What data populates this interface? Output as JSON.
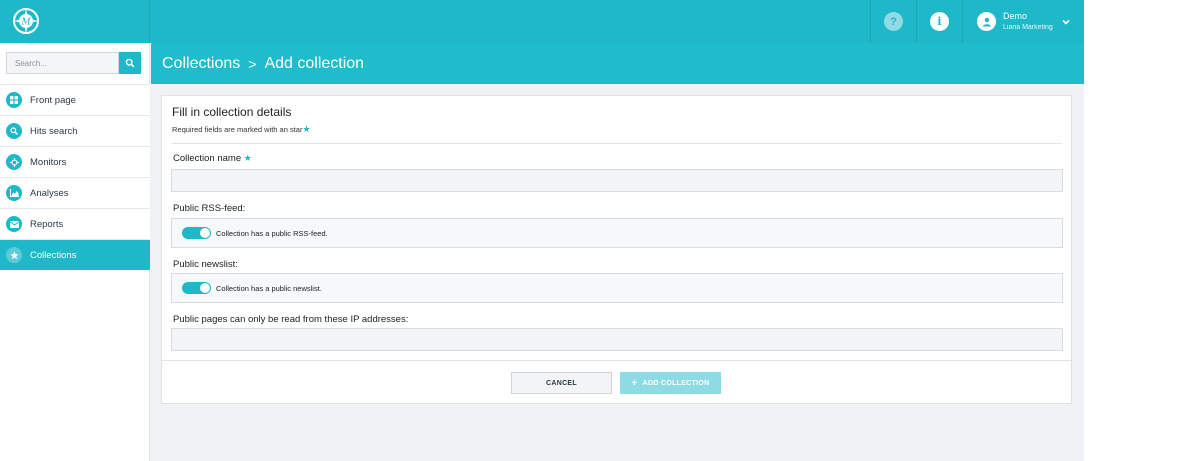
{
  "topbar": {
    "help_icon": "question-icon",
    "info_icon": "info-icon",
    "user": {
      "name": "Demo",
      "org": "Liana Marketing"
    }
  },
  "sidebar": {
    "search_placeholder": "Search...",
    "items": [
      {
        "label": "Front page",
        "icon": "dashboard-icon",
        "active": false
      },
      {
        "label": "Hits search",
        "icon": "search-icon",
        "active": false
      },
      {
        "label": "Monitors",
        "icon": "compass-icon",
        "active": false
      },
      {
        "label": "Analyses",
        "icon": "chart-icon",
        "active": false
      },
      {
        "label": "Reports",
        "icon": "envelope-icon",
        "active": false
      },
      {
        "label": "Collections",
        "icon": "star-icon",
        "active": true
      }
    ]
  },
  "breadcrumb": {
    "parent": "Collections",
    "separator": ">",
    "current": "Add collection"
  },
  "form": {
    "title": "Fill in collection details",
    "subtitle": "Required fields are marked with an star",
    "required_mark": "★",
    "collection_name_label": "Collection name",
    "collection_name_value": "",
    "rss_label": "Public RSS-feed:",
    "rss_toggle_text": "Collection has a public RSS-feed.",
    "rss_enabled": true,
    "newslist_label": "Public newslist:",
    "newslist_toggle_text": "Collection has a public newslist.",
    "newslist_enabled": true,
    "ip_label": "Public pages can only be read from these IP addresses:",
    "ip_value": ""
  },
  "actions": {
    "cancel": "CANCEL",
    "add": "ADD COLLECTION",
    "add_icon": "+"
  },
  "colors": {
    "accent": "#1eb8c8",
    "accent_light": "#8fdbe3",
    "background": "#f0f2f5"
  }
}
